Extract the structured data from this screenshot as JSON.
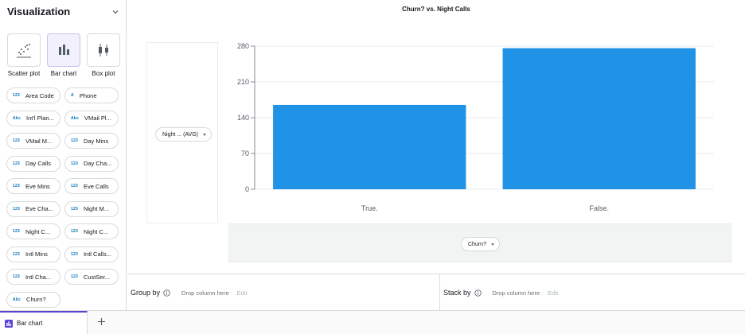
{
  "sidebar": {
    "title": "Visualization",
    "viz_types": [
      {
        "label": "Scatter plot",
        "icon": "scatter-plot-icon",
        "active": false
      },
      {
        "label": "Bar chart",
        "icon": "bar-chart-icon",
        "active": true
      },
      {
        "label": "Box plot",
        "icon": "box-plot-icon",
        "active": false
      }
    ],
    "columns": [
      {
        "type": "123",
        "label": "Area Code"
      },
      {
        "type": "A",
        "label": "Phone"
      },
      {
        "type": "Abc",
        "label": "Int'l Plan..."
      },
      {
        "type": "Abc",
        "label": "VMail Pl..."
      },
      {
        "type": "123",
        "label": "VMail M..."
      },
      {
        "type": "123",
        "label": "Day Mins"
      },
      {
        "type": "123",
        "label": "Day Calls"
      },
      {
        "type": "123",
        "label": "Day Cha..."
      },
      {
        "type": "123",
        "label": "Eve Mins"
      },
      {
        "type": "123",
        "label": "Eve Calls"
      },
      {
        "type": "123",
        "label": "Eve Cha..."
      },
      {
        "type": "123",
        "label": "Night M..."
      },
      {
        "type": "123",
        "label": "Night C..."
      },
      {
        "type": "123",
        "label": "Night C..."
      },
      {
        "type": "123",
        "label": "Intl Mins"
      },
      {
        "type": "123",
        "label": "Intl Calls..."
      },
      {
        "type": "123",
        "label": "Intl Cha..."
      },
      {
        "type": "123",
        "label": "CustSer..."
      },
      {
        "type": "Abc",
        "label": "Churn?"
      }
    ]
  },
  "main": {
    "y_axis_pill": "Night ... (AVG)",
    "x_axis_pill": "Churn?"
  },
  "shelves": {
    "group_by_label": "Group by",
    "stack_by_label": "Stack by",
    "drop_placeholder": "Drop column here",
    "edit_label": "Edit"
  },
  "tabs": [
    {
      "label": "Bar chart"
    }
  ],
  "colors": {
    "bar": "#2193e6",
    "accent": "#5a44d6"
  },
  "chart_data": {
    "type": "bar",
    "title": "Churn? vs. Night Calls",
    "categories": [
      "True.",
      "False."
    ],
    "values": [
      165,
      276
    ],
    "ylim": [
      0,
      280
    ],
    "yticks": [
      0,
      70,
      140,
      210,
      280
    ],
    "xlabel": "",
    "ylabel": "",
    "grid": true,
    "legend": false
  }
}
